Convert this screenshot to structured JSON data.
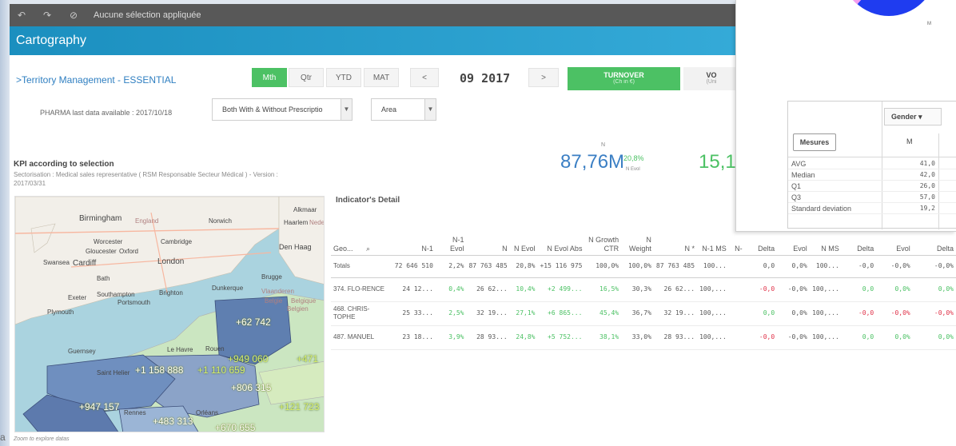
{
  "selection_bar": {
    "text": "Aucune sélection appliquée"
  },
  "app": {
    "title": "Cartography"
  },
  "header": {
    "territory_link": ">Territory Management - ESSENTIAL",
    "period_tabs": [
      "Mth",
      "Qtr",
      "YTD",
      "MAT"
    ],
    "active_tab": "Mth",
    "prev_label": "<",
    "next_label": ">",
    "period": "09 2017",
    "turnover_label": "TURNOVER",
    "turnover_sub": "(Ch in €)",
    "vol_label": "VO",
    "vol_sub": "(Uni"
  },
  "filters": {
    "pharma_text": "PHARMA last data available : 2017/10/18",
    "prescription_value": "Both With & Without Prescriptio",
    "area_value": "Area"
  },
  "kpi": {
    "title": "KPI according to selection",
    "subtitle": "Sectorisation : Medical sales representative ( RSM Responsable Secteur Médical ) - Version : 2017/03/31",
    "n_label": "N",
    "n_value": "87,76M",
    "n_evol_pct": "20,8%",
    "n_evol_label": "N Evol",
    "second_value": "15,1"
  },
  "map": {
    "places": [
      "Birmingham",
      "England",
      "Norwich",
      "Worcester",
      "Cambridge",
      "Gloucester",
      "Oxford",
      "Swansea",
      "Cardiff",
      "London",
      "Bath",
      "Exeter",
      "Southampton",
      "Brighton",
      "Portsmouth",
      "Plymouth",
      "Guernsey",
      "Saint Helier",
      "Le Havre",
      "Rouen",
      "Rennes",
      "Orléans",
      "Brugge",
      "Dunkerque",
      "Den Haag",
      "Alkmaar",
      "Haarlem",
      "Nede",
      "Belgie",
      "Belgique",
      "Belgien",
      "Vlaanderen"
    ],
    "data_labels": [
      "+62 742",
      "+949 060",
      "+471",
      "+1 158 888",
      "+1 110 659",
      "+806 315",
      "+121 723",
      "+947 157",
      "+483 313",
      "+670 655"
    ],
    "footer": "Zoom to explore datas"
  },
  "detail": {
    "title": "Indicator's Detail",
    "columns": [
      "Geo...",
      "N-1",
      "N-1 Evol",
      "N",
      "N Evol",
      "N Evol Abs",
      "N Growth CTR",
      "N Weight",
      "N *",
      "N-1 MS",
      "N-",
      "Delta",
      "Evol",
      "N MS",
      "Delta",
      "Evol",
      "Delta"
    ],
    "totals": [
      "Totals",
      "72 646 510",
      "2,2%",
      "87 763 485",
      "20,8%",
      "+15 116 975",
      "100,0%",
      "100,0%",
      "87 763 485",
      "100...",
      "",
      "0,0",
      "0,0%",
      "100...",
      "-0,0",
      "-0,0%",
      "-0,0%"
    ],
    "rows": [
      [
        "374. FLO-RENCE",
        "24 12...",
        "0,4%",
        "26 62...",
        "10,4%",
        "+2 499...",
        "16,5%",
        "30,3%",
        "26 62...",
        "100,...",
        "",
        "-0,0",
        "-0,0%",
        "100,...",
        "0,0",
        "0,0%",
        "0,0%"
      ],
      [
        "468. CHRIS-TOPHE",
        "25 33...",
        "2,5%",
        "32 19...",
        "27,1%",
        "+6 865...",
        "45,4%",
        "36,7%",
        "32 19...",
        "100,...",
        "",
        "0,0",
        "0,0%",
        "100,...",
        "-0,0",
        "-0,0%",
        "-0,0%"
      ],
      [
        "487. MANUEL",
        "23 18...",
        "3,9%",
        "28 93...",
        "24,8%",
        "+5 752...",
        "38,1%",
        "33,0%",
        "28 93...",
        "100,...",
        "",
        "-0,0",
        "-0,0%",
        "100,...",
        "0,0",
        "0,0%",
        "0,0%"
      ]
    ]
  },
  "overlay": {
    "donut_label": "M",
    "gender_label": "Gender",
    "mesures_label": "Mesures",
    "m_header": "M",
    "stats": [
      {
        "k": "AVG",
        "v": "41,0"
      },
      {
        "k": "Median",
        "v": "42,0"
      },
      {
        "k": "Q1",
        "v": "26,0"
      },
      {
        "k": "Q3",
        "v": "57,0"
      },
      {
        "k": "Standard deviation",
        "v": "19,2"
      }
    ]
  },
  "corner_text": "a",
  "colors": {
    "accent_green": "#4cc164",
    "title_blue": "#2a9ad0",
    "value_blue": "#3b7fc4",
    "negative_red": "#e0334a"
  }
}
